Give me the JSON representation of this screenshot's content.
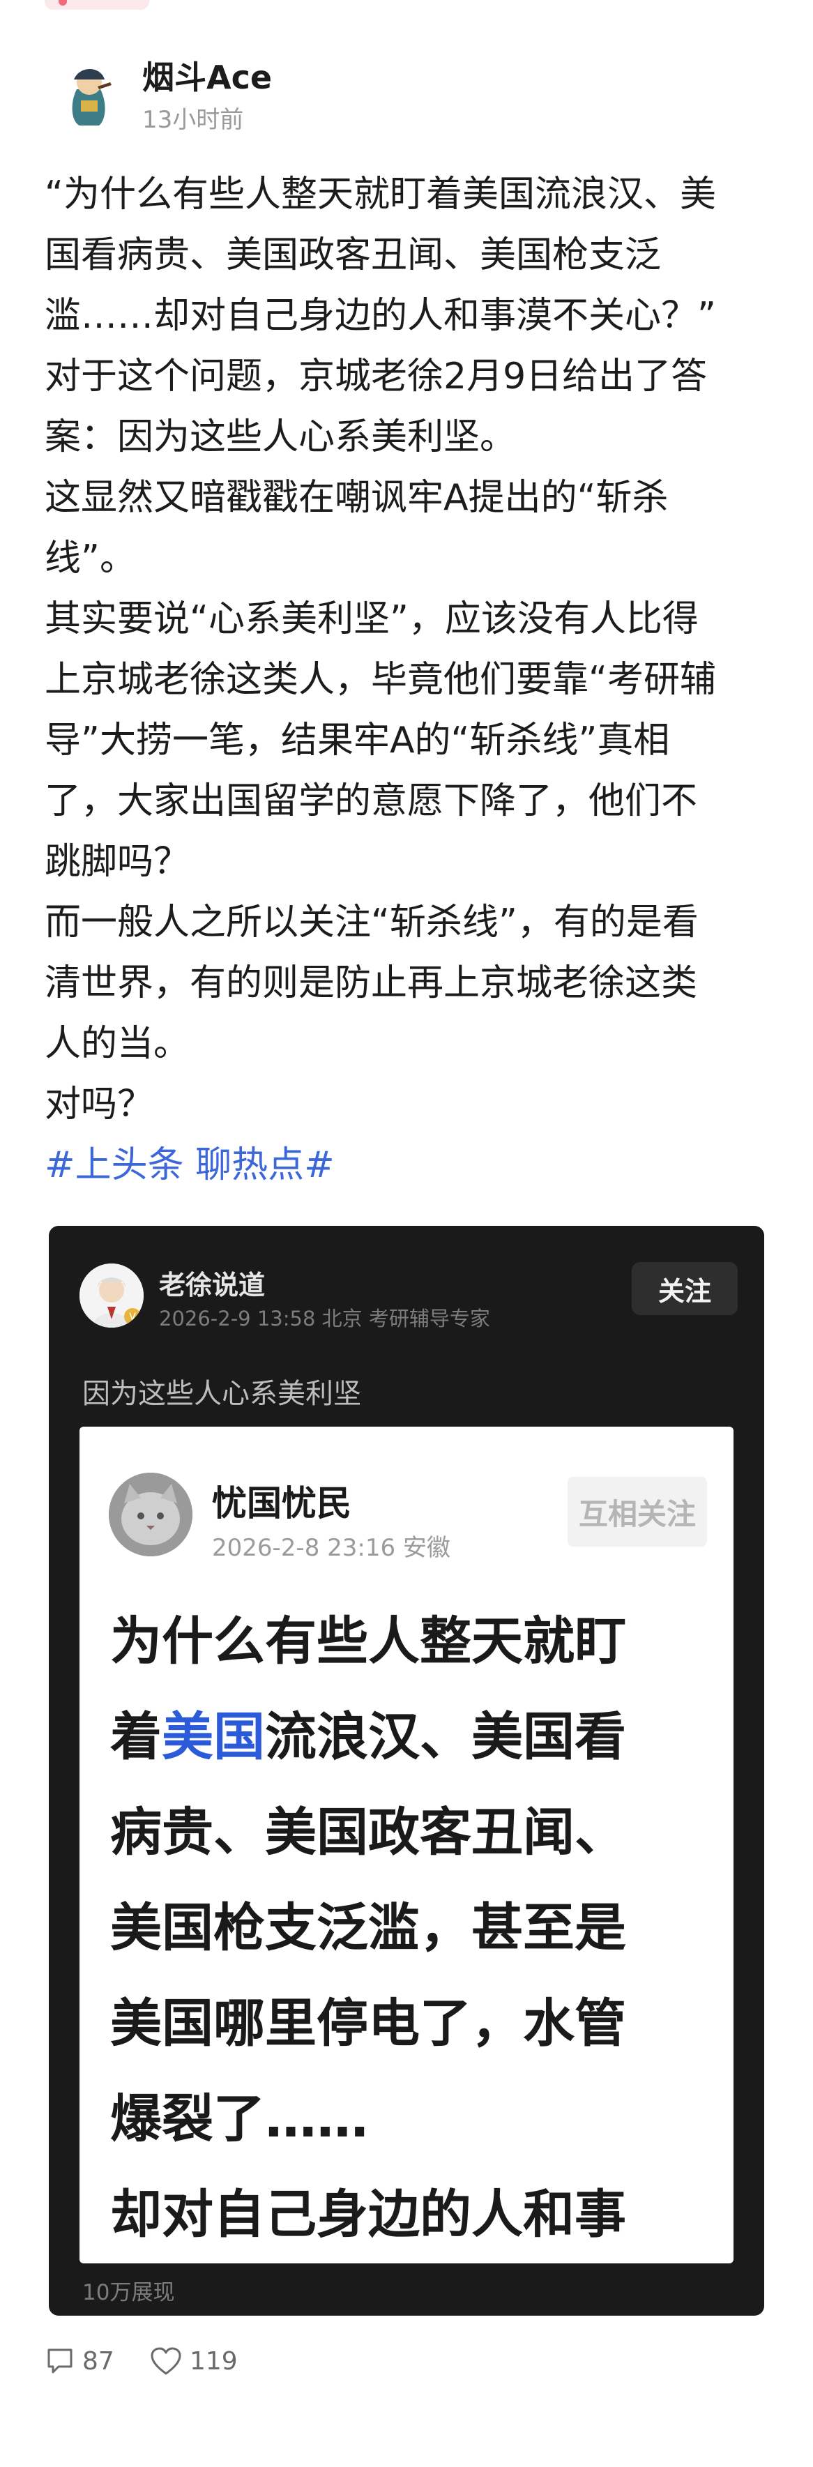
{
  "post": {
    "author": "烟斗Ace",
    "time": "13小时前",
    "paragraphs": [
      "“为什么有些人整天就盯着美国流浪汉、美\n国看病贵、美国政客丑闻、美国枪支泛\n滥……却对自己身边的人和事漠不关心？”",
      "对于这个问题，京城老徐2月9日给出了答\n案：因为这些人心系美利坚。",
      "这显然又暗戳戳在嘲讽牢A提出的“斩杀\n线”。",
      "其实要说“心系美利坚”，应该没有人比得\n上京城老徐这类人，毕竟他们要靠“考研辅\n导”大捞一笔，结果牢A的“斩杀线”真相\n了，大家出国留学的意愿下降了，他们不\n跳脚吗？",
      "而一般人之所以关注“斩杀线”，有的是看\n清世界，有的则是防止再上京城老徐这类\n人的当。",
      "对吗？"
    ],
    "hashtag": "#上头条 聊热点#"
  },
  "quoted": {
    "author": "老徐说道",
    "meta": "2026-2-9 13:58 北京 考研辅导专家",
    "follow_label": "关注",
    "text": "因为这些人心系美利坚",
    "views": "10万展现",
    "inner": {
      "author": "忧国忧民",
      "meta": "2026-2-8 23:16 安徽",
      "mutual_label": "互相关注",
      "line1": "为什么有些人整天就盯",
      "line2_pre": "着",
      "line2_link": "美国",
      "line2_post": "流浪汉、美国看",
      "rest": "病贵、美国政客丑闻、\n美国枪支泛滥，甚至是\n美国哪里停电了，水管\n爆裂了……\n却对自己身边的人和事\n漠不关心?"
    }
  },
  "footer": {
    "comments": "87",
    "likes": "119"
  },
  "colors": {
    "hashtag": "#3b67d9",
    "card_bg": "#1a1a1a",
    "link": "#2b5bd8"
  },
  "icons": [
    "comment-icon",
    "like-icon"
  ]
}
